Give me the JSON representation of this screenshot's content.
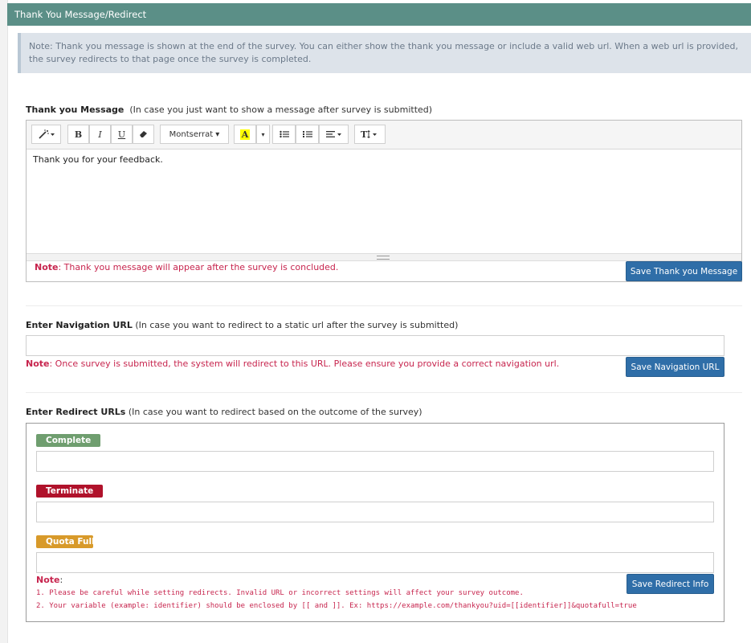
{
  "header": {
    "title": "Thank You Message/Redirect"
  },
  "info": {
    "text": "Note: Thank you message is shown at the end of the survey. You can either show the thank you message or include a valid web url. When a web url is provided, the survey redirects to that page once the survey is completed."
  },
  "thank_you": {
    "label": "Thank you Message",
    "hint": "(In case you just want to show a message after survey is submitted)",
    "toolbar": {
      "font": "Montserrat ▾",
      "bold": "B",
      "italic": "I",
      "underline": "U",
      "highlight": "A"
    },
    "body": "Thank you for your feedback.",
    "note_label": "Note",
    "note_text": ": Thank you message will appear after the survey is concluded.",
    "save_label": "Save Thank you Message"
  },
  "navigation": {
    "label": "Enter Navigation URL",
    "hint": "(In case you want to redirect to a static url after the survey is submitted)",
    "value": "",
    "note_label": "Note",
    "note_text": ": Once survey is submitted, the system will redirect to this URL. Please ensure you provide a correct navigation url.",
    "save_label": "Save Navigation URL"
  },
  "redirects": {
    "label": "Enter Redirect URLs",
    "hint": "(In case you want to redirect based on the outcome of the survey)",
    "complete": {
      "label": "Complete",
      "color": "#6f9e6f",
      "value": ""
    },
    "terminate": {
      "label": "Terminate",
      "color": "#b0122b",
      "value": ""
    },
    "quota": {
      "label": "Quota Full",
      "color": "#d89a2a",
      "value": ""
    },
    "note_label": "Note",
    "note_colon": ":",
    "note_1": "1. Please be careful while setting redirects. Invalid URL or incorrect settings will affect your survey outcome.",
    "note_2": "2. Your variable (example: identifier) should be enclosed by [[ and ]]. Ex: https://example.com/thankyou?uid=[[identifier]]&quotafull=true",
    "save_label": "Save Redirect Info"
  }
}
